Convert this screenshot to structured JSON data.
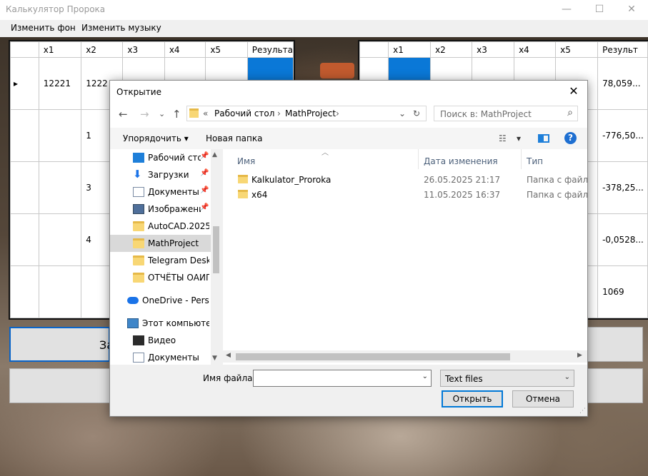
{
  "app": {
    "title": "Калькулятор Пророка",
    "controls": [
      "—",
      "☐",
      "✕"
    ]
  },
  "menu": [
    "Изменить фон",
    "Изменить музыку"
  ],
  "left_grid": {
    "headers": [
      "",
      "x1",
      "x2",
      "x3",
      "x4",
      "x5",
      "Результа"
    ],
    "rows": [
      [
        "▸",
        "12221",
        "1222",
        "",
        "",
        "",
        ""
      ],
      [
        "",
        "",
        "1",
        "",
        "",
        "",
        ""
      ],
      [
        "",
        "",
        "3",
        "",
        "",
        "",
        ""
      ],
      [
        "",
        "",
        "4",
        "",
        "",
        "",
        ""
      ],
      [
        "",
        "",
        "",
        "",
        "",
        "",
        ""
      ]
    ]
  },
  "right_grid": {
    "headers": [
      "",
      "x1",
      "x2",
      "x3",
      "x4",
      "x5",
      "Результ"
    ],
    "results": [
      "78,059...",
      "-776,50...",
      "-378,25...",
      "-0,0528...",
      "1069"
    ]
  },
  "bg_buttons": {
    "left_partial_label": "За"
  },
  "dialog": {
    "title": "Открытие",
    "close": "✕",
    "nav": {
      "back": "←",
      "forward": "→",
      "recent": "⌄",
      "up": "↑"
    },
    "address": {
      "prefix": "«",
      "parts": [
        "Рабочий стол",
        "MathProject"
      ],
      "sep": "›",
      "dropdown": "⌄",
      "refresh": "↻"
    },
    "search_placeholder": "Поиск в: MathProject",
    "toolbar": {
      "organize": "Упорядочить ▾",
      "new_folder": "Новая папка",
      "view": "▾",
      "help": "?"
    },
    "nav_pane": [
      {
        "label": "Рабочий сто.",
        "icon": "desktop-icon",
        "pinned": true
      },
      {
        "label": "Загрузки",
        "icon": "downloads-icon",
        "pinned": true
      },
      {
        "label": "Документы",
        "icon": "documents-icon",
        "pinned": true
      },
      {
        "label": "Изображени",
        "icon": "pictures-icon",
        "pinned": true
      },
      {
        "label": "AutoCAD.2025",
        "icon": "folder-icon",
        "pinned": false
      },
      {
        "label": "MathProject",
        "icon": "folder-icon",
        "pinned": false,
        "selected": true
      },
      {
        "label": "Telegram Deskto",
        "icon": "folder-icon",
        "pinned": false
      },
      {
        "label": "ОТЧЁТЫ ОАИП",
        "icon": "folder-icon",
        "pinned": false
      },
      {
        "label": "OneDrive - Person",
        "icon": "onedrive-icon",
        "pinned": false
      },
      {
        "label": "Этот компьютер",
        "icon": "this-pc-icon",
        "pinned": false
      },
      {
        "label": "Видео",
        "icon": "video-icon",
        "pinned": false
      },
      {
        "label": "Документы",
        "icon": "documents-icon",
        "pinned": false
      }
    ],
    "columns": {
      "name": "Имя",
      "date": "Дата изменения",
      "type": "Тип"
    },
    "files": [
      {
        "name": "Kalkulator_Proroka",
        "date": "26.05.2025 21:17",
        "type": "Папка с файлами"
      },
      {
        "name": "x64",
        "date": "11.05.2025 16:37",
        "type": "Папка с файлами"
      }
    ],
    "filename_label": "Имя файла:",
    "filename_value": "",
    "filter_value": "Text files",
    "open_button": "Открыть",
    "cancel_button": "Отмена"
  }
}
